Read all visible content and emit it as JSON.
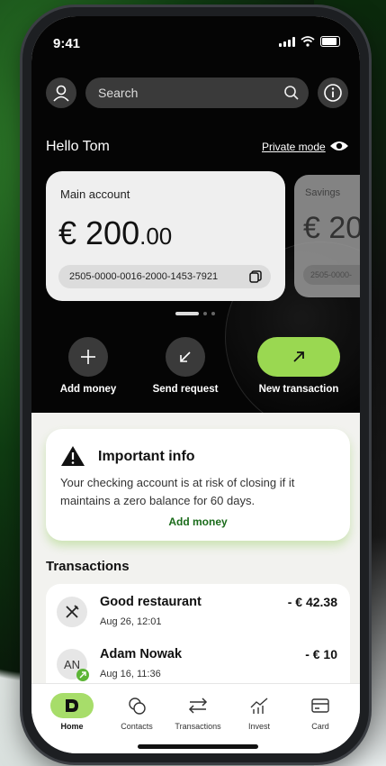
{
  "status_bar": {
    "time": "9:41"
  },
  "header": {
    "search_placeholder": "Search",
    "greeting": "Hello Tom",
    "private_mode_label": "Private mode"
  },
  "accounts": [
    {
      "label": "Main account",
      "amount_whole": "€ 200",
      "amount_decimal": ".00",
      "iban": "2505-0000-0016-2000-1453-7921"
    },
    {
      "label": "Savings",
      "amount_whole": "€ 20",
      "iban": "2505-0000-"
    }
  ],
  "carousel": {
    "pages": 3,
    "active": 0
  },
  "actions": [
    {
      "label": "Add money",
      "icon": "plus-icon"
    },
    {
      "label": "Send request",
      "icon": "arrow-down-left-icon"
    },
    {
      "label": "New transaction",
      "icon": "arrow-up-right-icon"
    }
  ],
  "notice": {
    "title": "Important info",
    "text": "Your checking account is at risk of closing if it maintains a zero balance for 60 days.",
    "link": "Add money"
  },
  "transactions": {
    "title": "Transactions",
    "items": [
      {
        "name": "Good restaurant",
        "date": "Aug 26, 12:01",
        "amount": "- € 42.38",
        "avatar": "cutlery-icon"
      },
      {
        "name": "Adam Nowak",
        "date": "Aug 16, 11:36",
        "amount": "- € 10",
        "avatar_initials": "AN"
      }
    ]
  },
  "tabbar": [
    {
      "label": "Home",
      "icon": "home-logo-icon",
      "active": true
    },
    {
      "label": "Contacts",
      "icon": "contacts-icon"
    },
    {
      "label": "Transactions",
      "icon": "transfer-icon"
    },
    {
      "label": "Invest",
      "icon": "chart-icon"
    },
    {
      "label": "Card",
      "icon": "card-icon"
    }
  ],
  "colors": {
    "accent_green": "#9ad851",
    "dark": "#050505",
    "link_green": "#1a6b1a"
  }
}
